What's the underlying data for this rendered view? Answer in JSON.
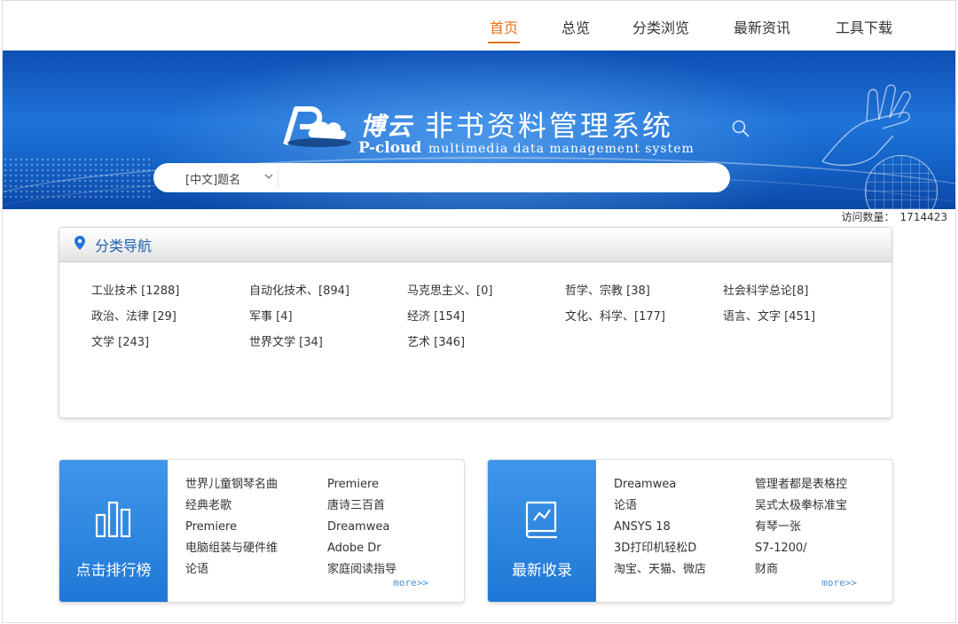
{
  "nav": {
    "items": [
      {
        "label": "首页",
        "active": true
      },
      {
        "label": "总览",
        "active": false
      },
      {
        "label": "分类浏览",
        "active": false
      },
      {
        "label": "最新资讯",
        "active": false
      },
      {
        "label": "工具下载",
        "active": false
      }
    ]
  },
  "banner": {
    "brand_cn": "博云",
    "title_cn": "非书资料管理系统",
    "brand_en": "P-cloud",
    "subtitle_en": "multimedia data management system"
  },
  "search": {
    "field_selected": "[中文]题名",
    "value": ""
  },
  "visits": {
    "label": "访问数量：",
    "count": "1714423"
  },
  "categories": {
    "title": "分类导航",
    "items": [
      "工业技术 [1288]",
      "自动化技术、[894]",
      "马克思主义、[0]",
      "哲学、宗教 [38]",
      "社会科学总论[8]",
      "政治、法律 [29]",
      "军事 [4]",
      "经济 [154]",
      "文化、科学、[177]",
      "语言、文字 [451]",
      "文学 [243]",
      "世界文学 [34]",
      "艺术 [346]"
    ]
  },
  "ranking": {
    "label": "点击排行榜",
    "col1": [
      "世界儿童钢琴名曲",
      "经典老歌",
      "Premiere",
      "电脑组装与硬件维",
      "论语"
    ],
    "col2": [
      "Premiere",
      "唐诗三百首",
      "Dreamwea",
      "Adobe Dr",
      "家庭阅读指导"
    ],
    "more": "more>>"
  },
  "latest": {
    "label": "最新收录",
    "col1": [
      "Dreamwea",
      "论语",
      "ANSYS 18",
      "3D打印机轻松D",
      "淘宝、天猫、微店"
    ],
    "col2": [
      "管理者都是表格控",
      "吴式太极拳标准宝",
      "有琴一张",
      "S7-1200/",
      "财商"
    ],
    "more": "more>>"
  },
  "colors": {
    "accent": "#e8731c",
    "link_blue": "#1f5fb0",
    "card_blue": "#2a84dd"
  }
}
